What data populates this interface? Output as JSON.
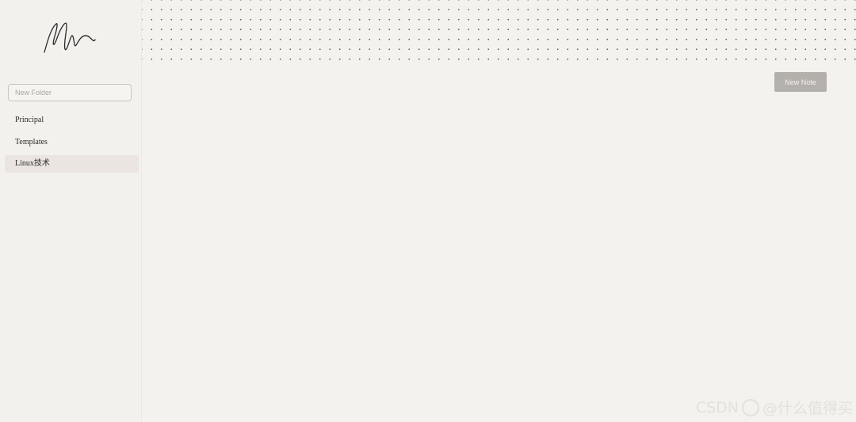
{
  "sidebar": {
    "logo_icon": "signature-logo-icon",
    "folder_input": {
      "value": "",
      "placeholder": "New Folder"
    },
    "folders": [
      {
        "label": "Principal",
        "active": false
      },
      {
        "label": "Templates",
        "active": false
      },
      {
        "label": "Linux技术",
        "active": true
      }
    ]
  },
  "main": {
    "new_note_label": "New Note"
  },
  "watermark": {
    "prefix": "CSDN",
    "handle": "@什么值得买"
  },
  "colors": {
    "background": "#f4f2ee",
    "active_folder": "#ebe5e2",
    "button": "#b4b1ad",
    "dots": "#6b6864"
  }
}
